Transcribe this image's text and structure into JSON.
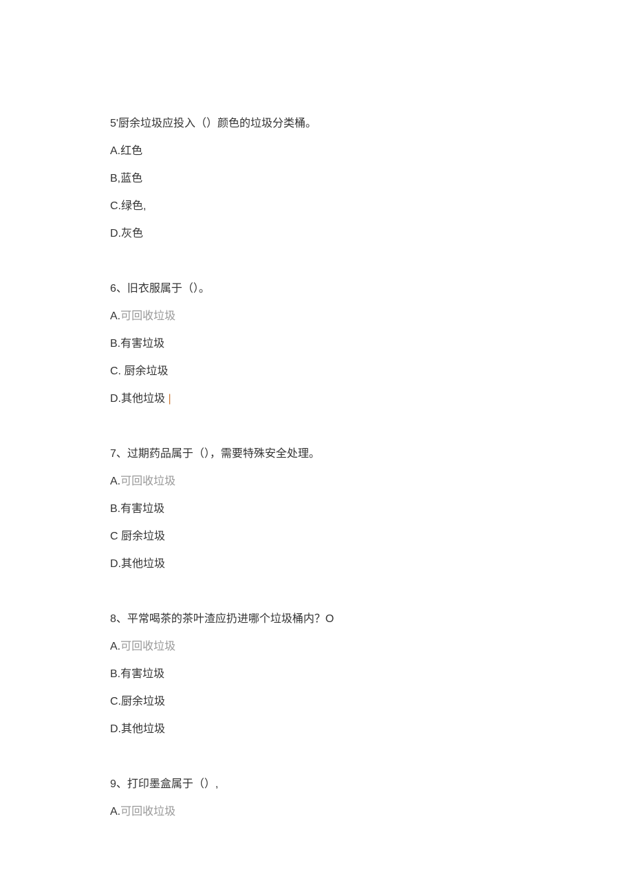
{
  "questions": [
    {
      "number": "5'",
      "text": "厨余垃圾应投入（）颜色的垃圾分类桶。",
      "options": [
        {
          "label": "A.",
          "text": "红色"
        },
        {
          "label": "B,",
          "text": "蓝色"
        },
        {
          "label": "C.",
          "text": "绿色,"
        },
        {
          "label": "D.",
          "text": "灰色"
        }
      ]
    },
    {
      "number": "6、",
      "text": "旧衣服属于（）。",
      "options": [
        {
          "label": "A.",
          "text": "可回收垃圾",
          "gray": true
        },
        {
          "label": "B.",
          "text": "有害垃圾"
        },
        {
          "label": "C. ",
          "text": "厨余垃圾"
        },
        {
          "label": "D.",
          "text": "其他垃圾",
          "cursor": true
        }
      ]
    },
    {
      "number": "7、",
      "text": "过期药品属于（），需要特殊安全处理。",
      "options": [
        {
          "label": "A.",
          "text": "可回收垃圾",
          "gray": true
        },
        {
          "label": "B.",
          "text": "有害垃圾"
        },
        {
          "label": "C ",
          "text": "厨余垃圾"
        },
        {
          "label": "D.",
          "text": "其他垃圾"
        }
      ]
    },
    {
      "number": "8、",
      "text": "平常喝茶的茶叶渣应扔进哪个垃圾桶内？O",
      "options": [
        {
          "label": "A.",
          "text": "可回收垃圾",
          "gray": true
        },
        {
          "label": "B.",
          "text": "有害垃圾"
        },
        {
          "label": "C.",
          "text": "厨余垃圾"
        },
        {
          "label": "D.",
          "text": "其他垃圾"
        }
      ]
    },
    {
      "number": "9、",
      "text": "打印墨盒属于（）,",
      "options": [
        {
          "label": "A.",
          "text": "可回收垃圾",
          "gray": true
        }
      ]
    }
  ]
}
